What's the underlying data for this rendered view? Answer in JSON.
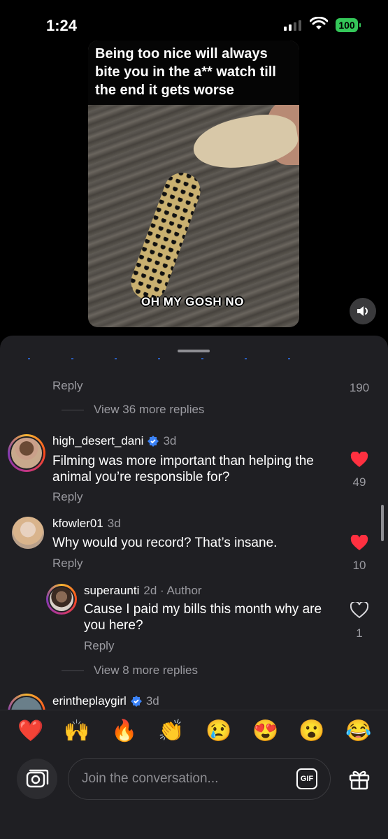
{
  "status_bar": {
    "time": "1:24",
    "battery": "100"
  },
  "video": {
    "top_caption": "Being too nice will always bite you in the a** watch till the end it gets worse",
    "bottom_caption": "OH MY GOSH NO"
  },
  "thread": {
    "prev_reply_label": "Reply",
    "prev_like_count": "190",
    "view_more_1": "View 36 more replies",
    "view_more_2": "View 8 more replies"
  },
  "comments": [
    {
      "username": "high_desert_dani",
      "verified": true,
      "time": "3d",
      "text": "Filming was more important than helping the animal you’re responsible for?",
      "reply_label": "Reply",
      "likes": "49",
      "liked": true
    },
    {
      "username": "kfowler01",
      "verified": false,
      "time": "3d",
      "text": "Why would you record? That’s insane.",
      "reply_label": "Reply",
      "likes": "10",
      "liked": true
    },
    {
      "username": "superaunti",
      "verified": false,
      "time": "2d · Author",
      "text": "Cause I paid my bills this month why are you here?",
      "reply_label": "Reply",
      "likes": "1",
      "liked": false
    },
    {
      "username": "erintheplaygirl",
      "verified": true,
      "time": "3d"
    }
  ],
  "emojis": [
    "❤️",
    "🙌",
    "🔥",
    "👏",
    "😢",
    "😍",
    "😮",
    "😂"
  ],
  "composer": {
    "placeholder": "Join the conversation...",
    "gif_label": "GIF"
  },
  "colors": {
    "accent_blue": "#3b82f6",
    "like_red": "#ff3040",
    "battery_green": "#34c759"
  }
}
